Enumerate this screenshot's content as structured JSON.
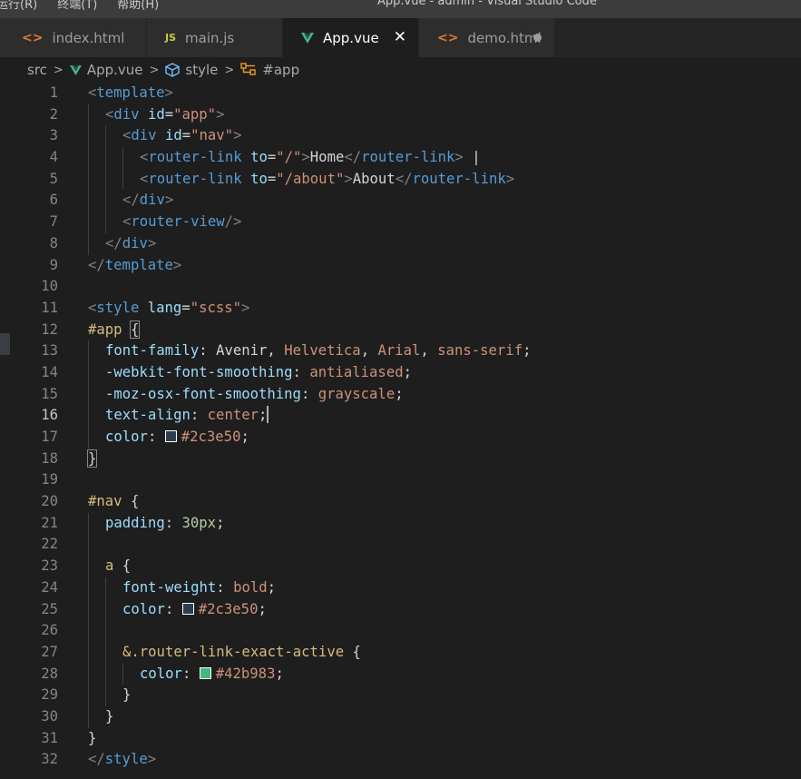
{
  "titlebar": {
    "menu": [
      "运行(R)",
      "终端(T)",
      "帮助(H)"
    ],
    "window_title": "App.vue - admin - Visual Studio Code"
  },
  "tabs": [
    {
      "label": "index.html",
      "icon": "html-file-icon",
      "state": "normal"
    },
    {
      "label": "main.js",
      "icon": "js-file-icon",
      "state": "normal"
    },
    {
      "label": "App.vue",
      "icon": "vue-file-icon",
      "state": "active"
    },
    {
      "label": "demo.html",
      "icon": "html-file-icon",
      "state": "modified"
    }
  ],
  "tab_glyphs": {
    "html": "<>",
    "js": "JS",
    "close": "✕"
  },
  "breadcrumb": {
    "src": "src",
    "file": "App.vue",
    "style": "style",
    "selector": "#app",
    "sep": ">"
  },
  "colors": {
    "vue_green": "#42b983",
    "swatch_dark": "#2c3e50",
    "html_icon": "#e37933",
    "js_icon": "#cbcb41"
  },
  "editor": {
    "current_line": 16,
    "lines": [
      {
        "n": "1"
      },
      {
        "n": "2"
      },
      {
        "n": "3"
      },
      {
        "n": "4"
      },
      {
        "n": "5"
      },
      {
        "n": "6"
      },
      {
        "n": "7"
      },
      {
        "n": "8"
      },
      {
        "n": "9"
      },
      {
        "n": "10"
      },
      {
        "n": "11"
      },
      {
        "n": "12"
      },
      {
        "n": "13"
      },
      {
        "n": "14"
      },
      {
        "n": "15"
      },
      {
        "n": "16"
      },
      {
        "n": "17"
      },
      {
        "n": "18"
      },
      {
        "n": "19"
      },
      {
        "n": "20"
      },
      {
        "n": "21"
      },
      {
        "n": "22"
      },
      {
        "n": "23"
      },
      {
        "n": "24"
      },
      {
        "n": "25"
      },
      {
        "n": "26"
      },
      {
        "n": "27"
      },
      {
        "n": "28"
      },
      {
        "n": "29"
      },
      {
        "n": "30"
      },
      {
        "n": "31"
      },
      {
        "n": "32"
      }
    ],
    "t": {
      "lt": "<",
      "gt": ">",
      "ltslash": "</",
      "slashgt": "/>",
      "eq": "=",
      "template": "template",
      "div": "div",
      "id": "id",
      "app_q": "\"app\"",
      "nav_q": "\"nav\"",
      "router_link": "router-link",
      "to": "to",
      "root_q": "\"/\"",
      "about_q": "\"/about\"",
      "home": "Home",
      "about": "About",
      "pipe": " |",
      "router_view": "router-view",
      "style": "style",
      "lang": "lang",
      "scss_q": "\"scss\"",
      "sel_app": "#app",
      "brace_open": "{",
      "brace_close": "}",
      "sel_nav": "#nav ",
      "sel_a": "a ",
      "sel_exact": "&.router-link-exact-active ",
      "font_family": "font-family",
      "colon": ": ",
      "avenir": "Avenir",
      "comma": ", ",
      "helvetica": "Helvetica",
      "arial": "Arial",
      "sans_serif": "sans-serif",
      "semi": ";",
      "webkit_smooth": "-webkit-font-smoothing",
      "antialiased": "antialiased",
      "moz_smooth": "-moz-osx-font-smoothing",
      "grayscale": "grayscale",
      "text_align": "text-align",
      "center": "center",
      "color": "color",
      "hex_dark": "#2c3e50",
      "hex_green": "#42b983",
      "padding": "padding",
      "px30": "30px",
      "font_weight": "font-weight",
      "bold": "bold"
    }
  }
}
